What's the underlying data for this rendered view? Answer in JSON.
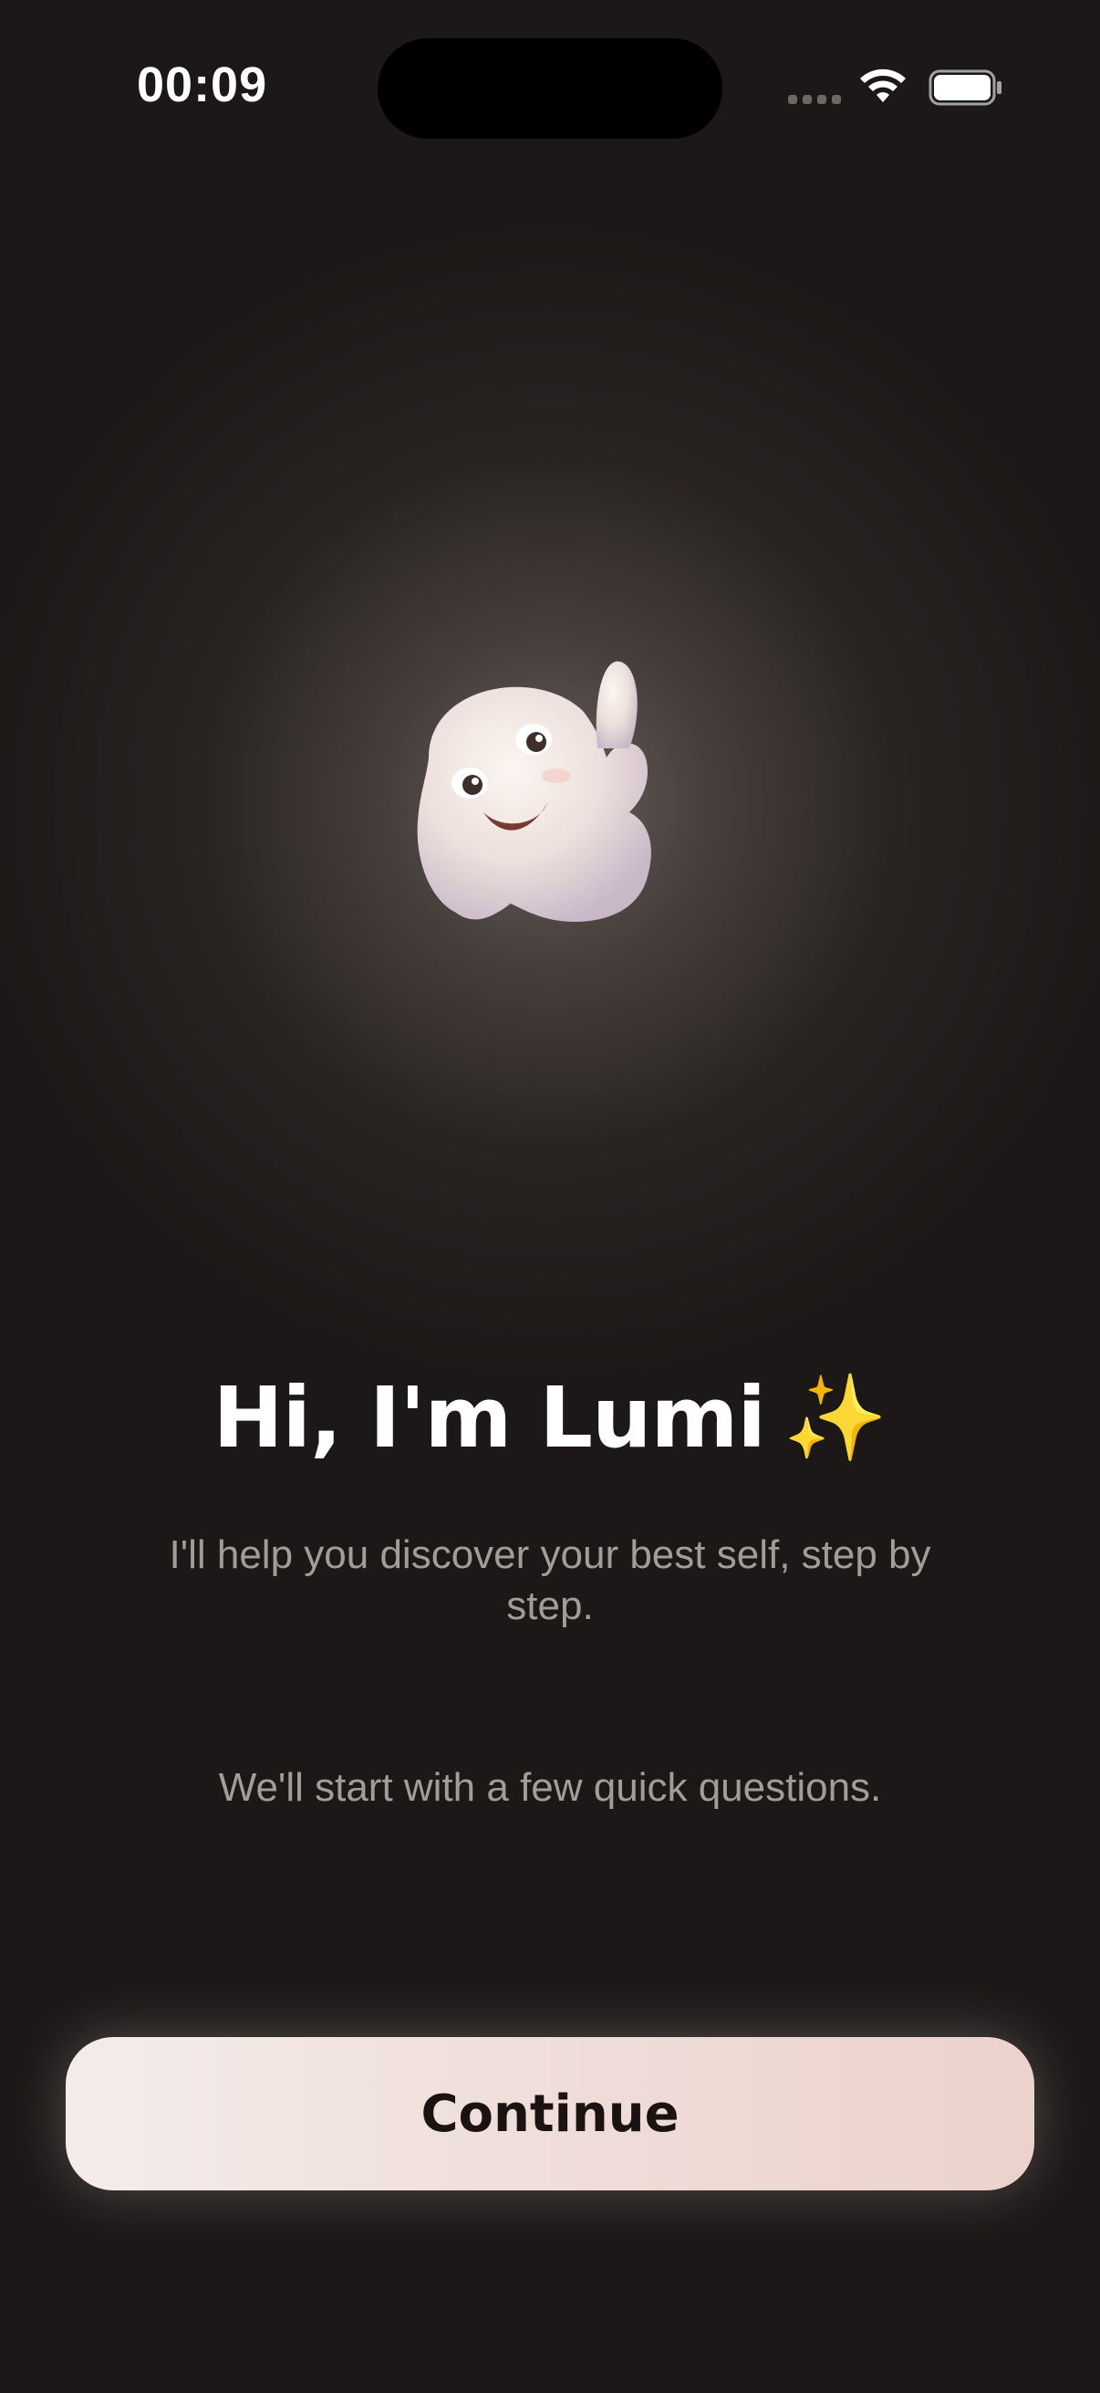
{
  "status_bar": {
    "time": "00:09",
    "icons": [
      "cellular-signal-icon",
      "wifi-icon",
      "battery-icon"
    ]
  },
  "mascot": {
    "icon": "ghost-mascot-waving",
    "name": "Lumi"
  },
  "content": {
    "title": "Hi, I'm Lumi",
    "title_emoji": "✨",
    "subtitle": "I'll help you discover your best self, step by step.",
    "note": "We'll start with a few quick questions."
  },
  "actions": {
    "continue_label": "Continue"
  },
  "colors": {
    "background": "#1b1817",
    "text_primary": "#ffffff",
    "text_secondary": "#a39d9a",
    "button_start": "#f4ece9",
    "button_end": "#ecd2cc",
    "button_text": "#1b1212",
    "sparkle": "#f8c64b"
  }
}
